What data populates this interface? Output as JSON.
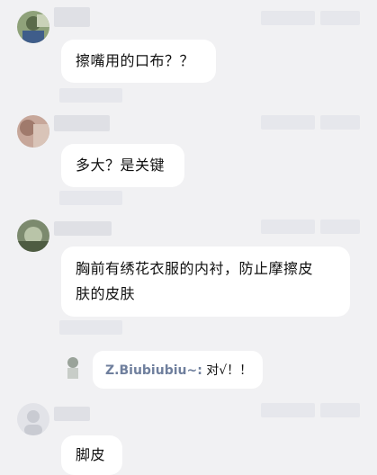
{
  "comments": [
    {
      "text": "擦嘴用的口布？？"
    },
    {
      "text": "多大？是关键"
    },
    {
      "text_line1": "胸前有绣花衣服的内衬，防止摩擦皮",
      "text_line2": "肤的皮肤"
    },
    {
      "text": "脚皮"
    }
  ],
  "reply": {
    "username": "Z.Biubiubiu~:",
    "text": "对√！！"
  }
}
